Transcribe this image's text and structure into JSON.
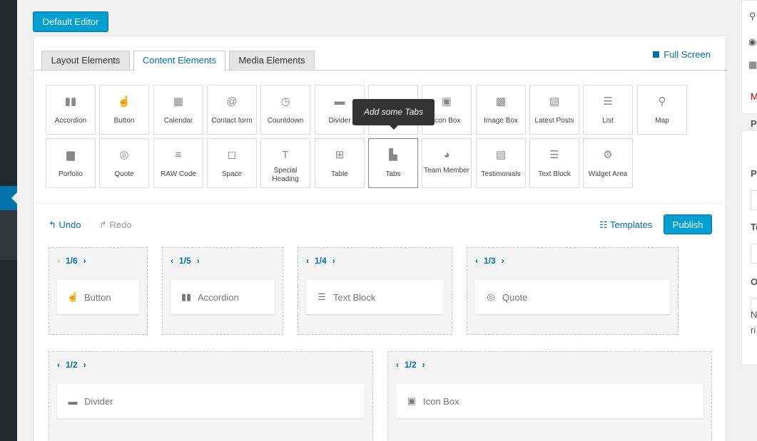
{
  "editor_button": "Default Editor",
  "tabs": [
    {
      "label": "Layout Elements"
    },
    {
      "label": "Content Elements"
    },
    {
      "label": "Media Elements"
    }
  ],
  "fullscreen_label": "Full Screen",
  "elements": [
    {
      "label": "Accordion",
      "icon": "accordion-icon",
      "glyph": "▮▮"
    },
    {
      "label": "Button",
      "icon": "pointer-hand-icon",
      "glyph": "☝"
    },
    {
      "label": "Calendar",
      "icon": "calendar-icon",
      "glyph": "▦"
    },
    {
      "label": "Contact form",
      "icon": "at-sign-icon",
      "glyph": "@"
    },
    {
      "label": "Countdown",
      "icon": "stopwatch-icon",
      "glyph": "◷"
    },
    {
      "label": "Divider",
      "icon": "divider-icon",
      "glyph": "▬"
    },
    {
      "label": "",
      "icon": "hidden-icon",
      "glyph": "▪"
    },
    {
      "label": "Icon Box",
      "icon": "icon-box-icon",
      "glyph": "▣"
    },
    {
      "label": "Image Box",
      "icon": "image-box-icon",
      "glyph": "▩"
    },
    {
      "label": "Latest Posts",
      "icon": "posts-icon",
      "glyph": "▤"
    },
    {
      "label": "List",
      "icon": "list-icon",
      "glyph": "☰"
    },
    {
      "label": "Map",
      "icon": "map-pin-icon",
      "glyph": "⚲"
    },
    {
      "label": "Porfolio",
      "icon": "briefcase-icon",
      "glyph": "▆"
    },
    {
      "label": "Quote",
      "icon": "speech-bubble-icon",
      "glyph": "◎"
    },
    {
      "label": "RAW Code",
      "icon": "code-lines-icon",
      "glyph": "≡"
    },
    {
      "label": "Space",
      "icon": "space-icon",
      "glyph": "◻"
    },
    {
      "label": "Special Heading",
      "icon": "heading-icon",
      "glyph": "T"
    },
    {
      "label": "Table",
      "icon": "table-icon",
      "glyph": "⊞"
    },
    {
      "label": "Tabs",
      "icon": "tabs-icon",
      "glyph": "▙"
    },
    {
      "label": "Team Member",
      "icon": "team-member-icon",
      "glyph": "◕"
    },
    {
      "label": "Testimonials",
      "icon": "testimonial-icon",
      "glyph": "▤"
    },
    {
      "label": "Text Block",
      "icon": "text-block-icon",
      "glyph": "☰"
    },
    {
      "label": "Widget Area",
      "icon": "gear-icon",
      "glyph": "⚙"
    }
  ],
  "tooltip": "Add some Tabs",
  "toolbar": {
    "undo": "Undo",
    "redo": "Redo",
    "templates": "Templates",
    "publish": "Publish"
  },
  "columns": [
    {
      "size": "1/6",
      "item": "Button"
    },
    {
      "size": "1/5",
      "item": "Accordion"
    },
    {
      "size": "1/4",
      "item": "Text Block"
    },
    {
      "size": "1/3",
      "item": "Quote"
    },
    {
      "size": "1/2",
      "item": "Divider"
    },
    {
      "size": "1/2",
      "item": "Icon Box"
    }
  ],
  "sidebar_fragments": [
    "M",
    "Pa",
    "Pa",
    "Te",
    "O",
    "N",
    "ri"
  ]
}
